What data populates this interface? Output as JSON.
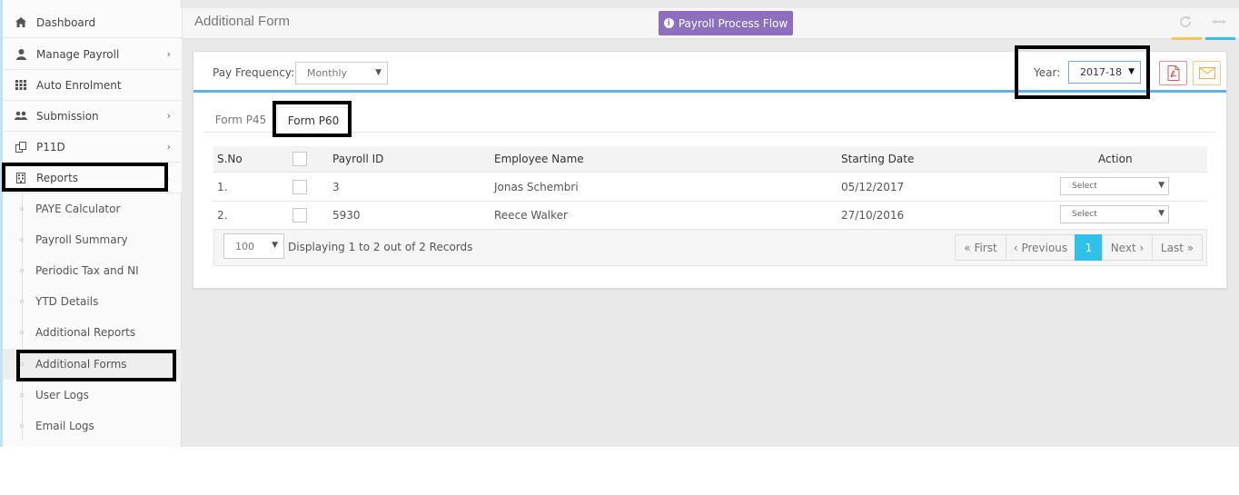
{
  "sidebar": {
    "items": [
      {
        "label": "Dashboard",
        "icon": "home-icon",
        "chevron": ""
      },
      {
        "label": "Manage Payroll",
        "icon": "user-icon",
        "chevron": "›"
      },
      {
        "label": "Auto Enrolment",
        "icon": "grid-icon",
        "chevron": ""
      },
      {
        "label": "Submission",
        "icon": "users-icon",
        "chevron": "›"
      },
      {
        "label": "P11D",
        "icon": "copy-icon",
        "chevron": "›"
      },
      {
        "label": "Reports",
        "icon": "building-icon",
        "chevron": "⌄"
      }
    ],
    "subitems": [
      {
        "label": "PAYE Calculator"
      },
      {
        "label": "Payroll Summary"
      },
      {
        "label": "Periodic Tax and NI"
      },
      {
        "label": "YTD Details"
      },
      {
        "label": "Additional Reports"
      },
      {
        "label": "Additional Forms"
      },
      {
        "label": "User Logs"
      },
      {
        "label": "Email Logs"
      }
    ]
  },
  "header": {
    "title": "Additional Form",
    "process_button": "Payroll Process Flow",
    "icons": [
      "refresh-icon",
      "arrows-icon"
    ],
    "accent_colors": [
      "#f7c54a",
      "#2fc1e8"
    ]
  },
  "filters": {
    "pay_frequency_label": "Pay Frequency:",
    "pay_frequency_value": "Monthly",
    "year_label": "Year:",
    "year_value": "2017-18"
  },
  "tabs": [
    {
      "label": "Form P45",
      "active": false
    },
    {
      "label": "Form P60",
      "active": true
    }
  ],
  "table": {
    "headers": {
      "sno": "S.No",
      "payroll_id": "Payroll ID",
      "employee_name": "Employee Name",
      "starting_date": "Starting Date",
      "action": "Action"
    },
    "rows": [
      {
        "sno": "1.",
        "payroll_id": "3",
        "employee_name": "Jonas Schembri",
        "starting_date": "05/12/2017",
        "action": "Select"
      },
      {
        "sno": "2.",
        "payroll_id": "5930",
        "employee_name": "Reece Walker",
        "starting_date": "27/10/2016",
        "action": "Select"
      }
    ]
  },
  "pagination": {
    "page_size": "100",
    "summary": "Displaying 1 to 2 out of 2 Records",
    "first": "« First",
    "previous": "‹ Previous",
    "current": "1",
    "next": "Next ›",
    "last": "Last »"
  },
  "colors": {
    "accent": "#2fc1e8",
    "purple_button": "#8e6fbf",
    "pdf": "#d9534f",
    "email": "#f0ad4e",
    "panel_rule": "#5fb1e8"
  }
}
